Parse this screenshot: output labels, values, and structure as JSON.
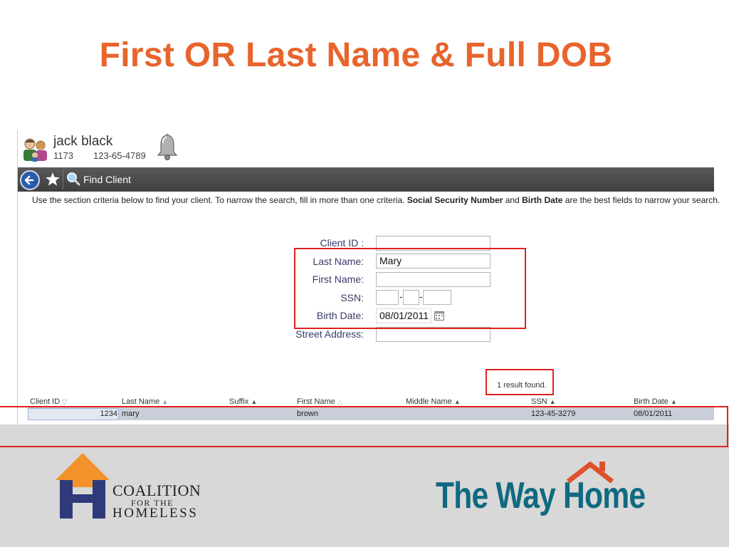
{
  "slide": {
    "title": "First OR Last Name & Full DOB"
  },
  "header": {
    "client_name": "jack black",
    "client_id": "1173",
    "client_ssn": "123-65-4789"
  },
  "nav": {
    "title": "Find Client"
  },
  "instructions": {
    "part1": "Use the section criteria below to find your client. To narrow the search, fill in more than one criteria. ",
    "bold1": "Social Security Number",
    "part2": " and ",
    "bold2": "Birth Date",
    "part3": " are the best fields to narrow your search."
  },
  "form": {
    "client_id_label": "Client ID :",
    "client_id_value": "",
    "last_name_label": "Last Name:",
    "last_name_value": "Mary",
    "first_name_label": "First Name:",
    "first_name_value": "",
    "ssn_label": "SSN:",
    "ssn_sep": "-",
    "birth_date_label": "Birth Date:",
    "birth_date_value": "08/01/2011",
    "street_label": "Street Address:",
    "street_value": ""
  },
  "results": {
    "count_text": "1 result found.",
    "columns": [
      "Client ID",
      "Last Name",
      "Suffix",
      "First Name",
      "Middle Name",
      "SSN",
      "Birth Date"
    ],
    "row": {
      "client_id": "1234",
      "last_name": "mary",
      "suffix": "",
      "first_name": "brown",
      "middle_name": "",
      "ssn": "123-45-3279",
      "birth_date": "08/01/2011"
    }
  },
  "footer": {
    "coalition_line1": "COALITION",
    "coalition_line2": "FOR THE",
    "coalition_line3": "HOMELESS",
    "wayhome": "The Way Home"
  },
  "colors": {
    "title": "#E8642C",
    "highlight": "#E02020",
    "nav_bar": "#4A4A4A",
    "wayhome": "#0F6A80",
    "coalition_orange": "#F3922B",
    "coalition_navy": "#2E3A7A"
  }
}
